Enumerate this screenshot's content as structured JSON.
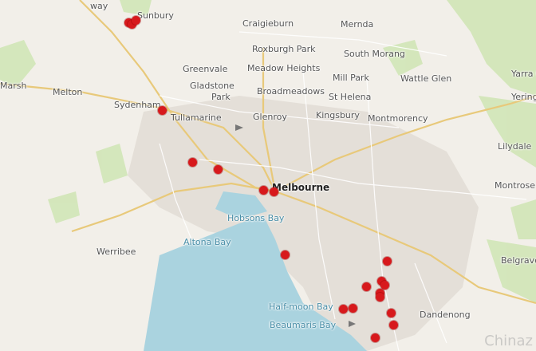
{
  "map": {
    "labels": [
      {
        "text": "Sunbury",
        "cls": ""
      },
      {
        "text": "Craigieburn",
        "cls": ""
      },
      {
        "text": "Mernda",
        "cls": ""
      },
      {
        "text": "Roxburgh Park",
        "cls": ""
      },
      {
        "text": "South Morang",
        "cls": ""
      },
      {
        "text": "Greenvale",
        "cls": ""
      },
      {
        "text": "Meadow Heights",
        "cls": ""
      },
      {
        "text": "Mill Park",
        "cls": ""
      },
      {
        "text": "Wattle Glen",
        "cls": ""
      },
      {
        "text": "Yarra G",
        "cls": ""
      },
      {
        "text": "Marsh",
        "cls": ""
      },
      {
        "text": "Melton",
        "cls": ""
      },
      {
        "text": "Gladstone",
        "cls": ""
      },
      {
        "text": "Park",
        "cls": ""
      },
      {
        "text": "Broadmeadows",
        "cls": ""
      },
      {
        "text": "St Helena",
        "cls": ""
      },
      {
        "text": "Yering",
        "cls": ""
      },
      {
        "text": "Sydenham",
        "cls": ""
      },
      {
        "text": "Tullamarine",
        "cls": ""
      },
      {
        "text": "Glenroy",
        "cls": ""
      },
      {
        "text": "Kingsbury",
        "cls": ""
      },
      {
        "text": "Montmorency",
        "cls": ""
      },
      {
        "text": "Lilydale",
        "cls": ""
      },
      {
        "text": "Melbourne",
        "cls": "big"
      },
      {
        "text": "Montrose",
        "cls": ""
      },
      {
        "text": "Hobsons Bay",
        "cls": "water"
      },
      {
        "text": "Altona Bay",
        "cls": "water"
      },
      {
        "text": "Werribee",
        "cls": ""
      },
      {
        "text": "Belgrave",
        "cls": ""
      },
      {
        "text": "Half-moon Bay",
        "cls": "water"
      },
      {
        "text": "Dandenong",
        "cls": ""
      },
      {
        "text": "Beaumaris Bay",
        "cls": "water"
      },
      {
        "text": "way",
        "cls": ""
      }
    ],
    "marker_count": 22,
    "marker_color": "#d7191c",
    "watermark": "Chinaz"
  }
}
